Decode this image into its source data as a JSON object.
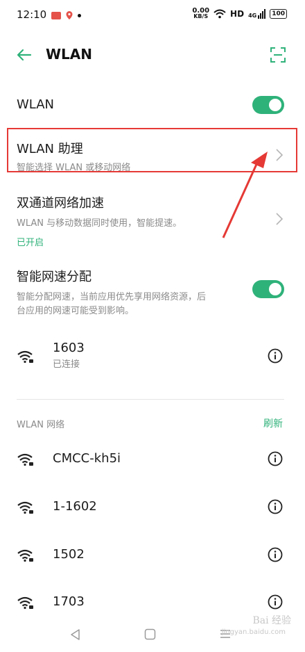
{
  "status_bar": {
    "time": "12:10",
    "net_speed_value": "0.00",
    "net_speed_unit": "KB/S",
    "hd": "HD",
    "signal": "4G",
    "battery": "100"
  },
  "header": {
    "title": "WLAN"
  },
  "wlan_toggle": {
    "label": "WLAN",
    "enabled": true
  },
  "wlan_assistant": {
    "title": "WLAN 助理",
    "subtitle": "智能选择 WLAN 或移动网络"
  },
  "dual_channel": {
    "title": "双通道网络加速",
    "subtitle": "WLAN 与移动数据同时使用，智能提速。",
    "status": "已开启"
  },
  "smart_speed": {
    "title": "智能网速分配",
    "subtitle_line1": "智能分配网速，当前应用优先享用网络资源，后",
    "subtitle_line2": "台应用的网速可能受到影响。",
    "enabled": true
  },
  "connected_network": {
    "name": "1603",
    "status": "已连接"
  },
  "networks_section": {
    "title": "WLAN 网络",
    "refresh_label": "刷新",
    "items": [
      {
        "name": "CMCC-kh5i"
      },
      {
        "name": "1-1602"
      },
      {
        "name": "1502"
      },
      {
        "name": "1703"
      }
    ]
  },
  "watermark": {
    "text": "Bai 经验",
    "url": "jingyan.baidu.com"
  },
  "colors": {
    "accent": "#2fb27a",
    "annotation": "#e53935"
  }
}
